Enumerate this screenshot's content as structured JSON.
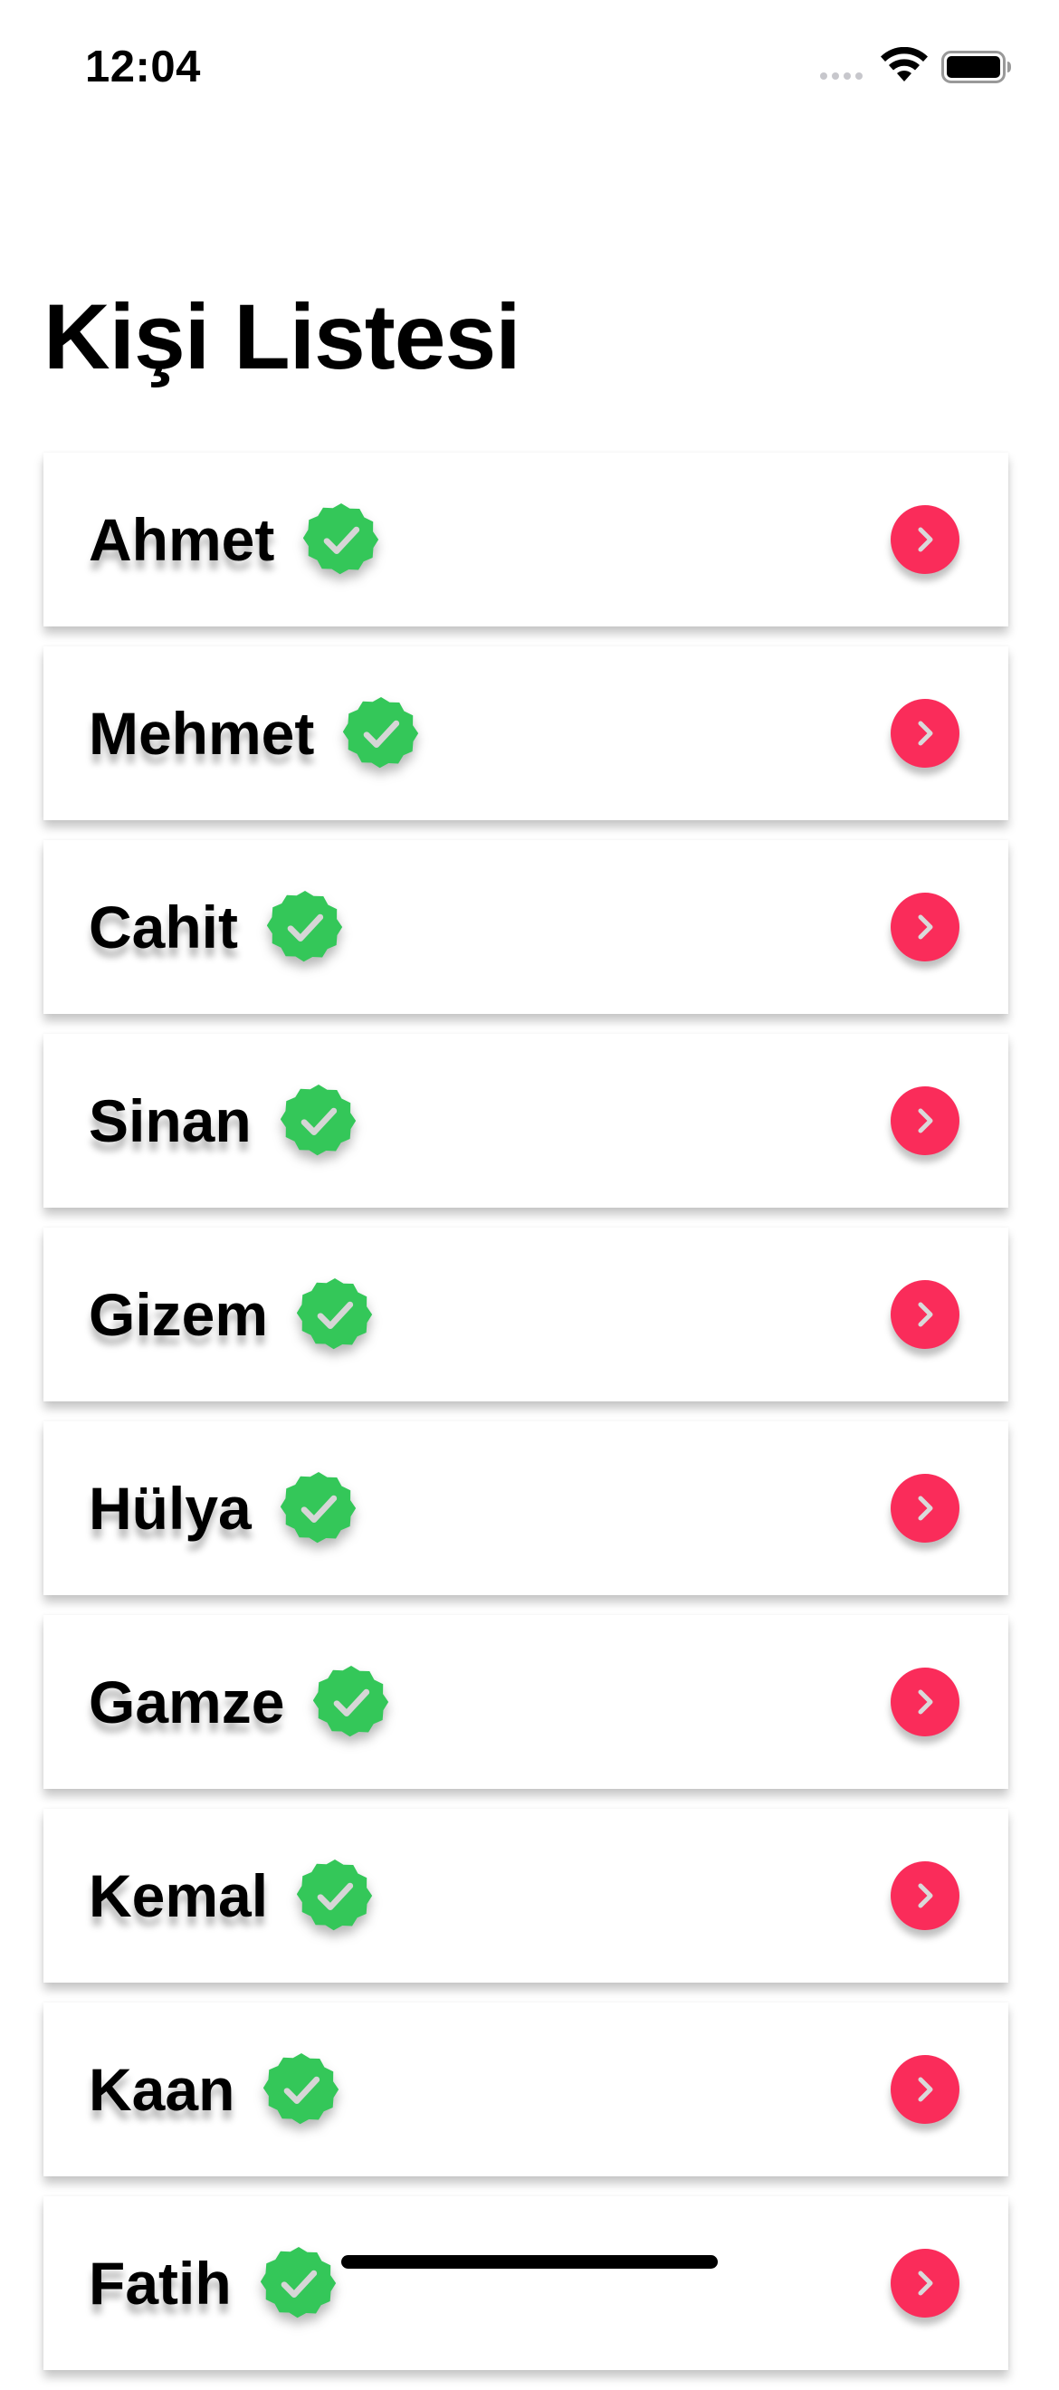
{
  "status_bar": {
    "time": "12:04"
  },
  "page": {
    "title": "Kişi Listesi"
  },
  "contacts": [
    {
      "name": "Ahmet",
      "verified": true
    },
    {
      "name": "Mehmet",
      "verified": true
    },
    {
      "name": "Cahit",
      "verified": true
    },
    {
      "name": "Sinan",
      "verified": true
    },
    {
      "name": "Gizem",
      "verified": true
    },
    {
      "name": "Hülya",
      "verified": true
    },
    {
      "name": "Gamze",
      "verified": true
    },
    {
      "name": "Kemal",
      "verified": true
    },
    {
      "name": "Kaan",
      "verified": true
    },
    {
      "name": "Fatih",
      "verified": true
    }
  ],
  "icons": {
    "verified": "verified-badge-icon",
    "open": "chevron-right-icon"
  },
  "colors": {
    "verified_badge": "#34c759",
    "chevron_button": "#fa2c5a",
    "background": "#ffffff"
  }
}
